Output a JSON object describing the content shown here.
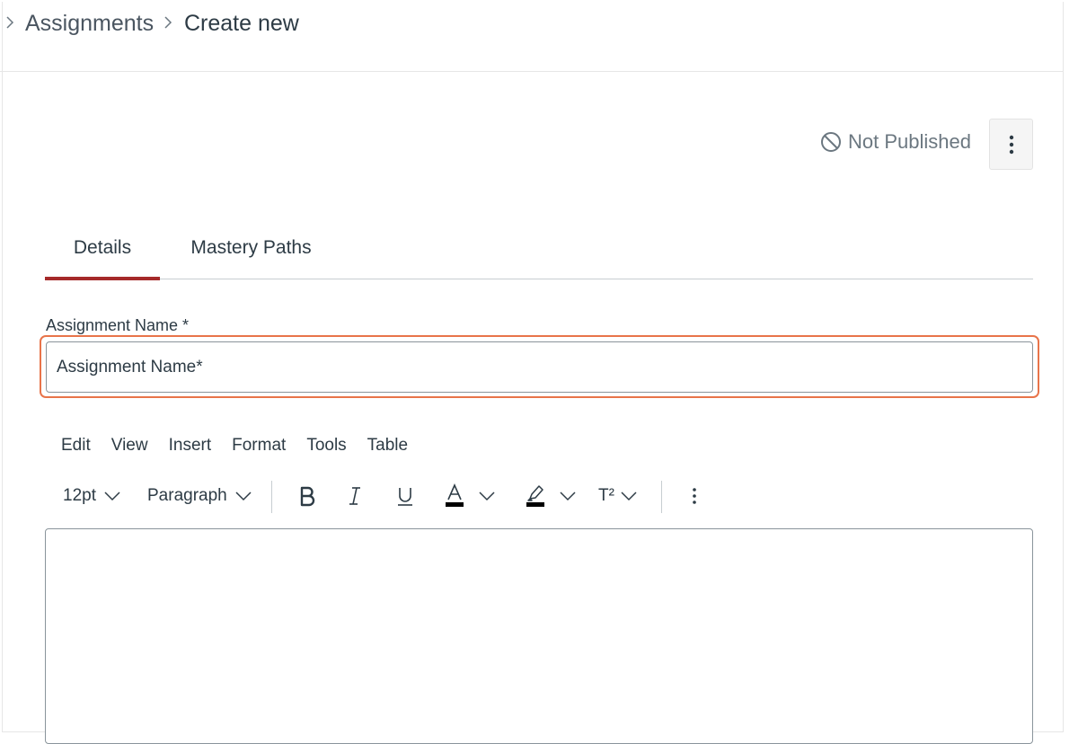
{
  "breadcrumb": {
    "items": [
      {
        "label": "Assignments"
      },
      {
        "label": "Create new"
      }
    ]
  },
  "header": {
    "status_label": "Not Published",
    "status_icon": "not-published-icon",
    "options_icon": "kebab-icon"
  },
  "tabs": [
    {
      "label": "Details",
      "active": true
    },
    {
      "label": "Mastery Paths",
      "active": false
    }
  ],
  "form": {
    "name_label": "Assignment Name *",
    "name_value": "Assignment Name*"
  },
  "editor": {
    "menu": [
      "Edit",
      "View",
      "Insert",
      "Format",
      "Tools",
      "Table"
    ],
    "font_size": "12pt",
    "block_format": "Paragraph",
    "superscript_label": "T²"
  },
  "colors": {
    "accent_tab": "#a52a2a",
    "focus_ring": "#e8744a",
    "text": "#2d3b45",
    "muted": "#6b7780"
  }
}
